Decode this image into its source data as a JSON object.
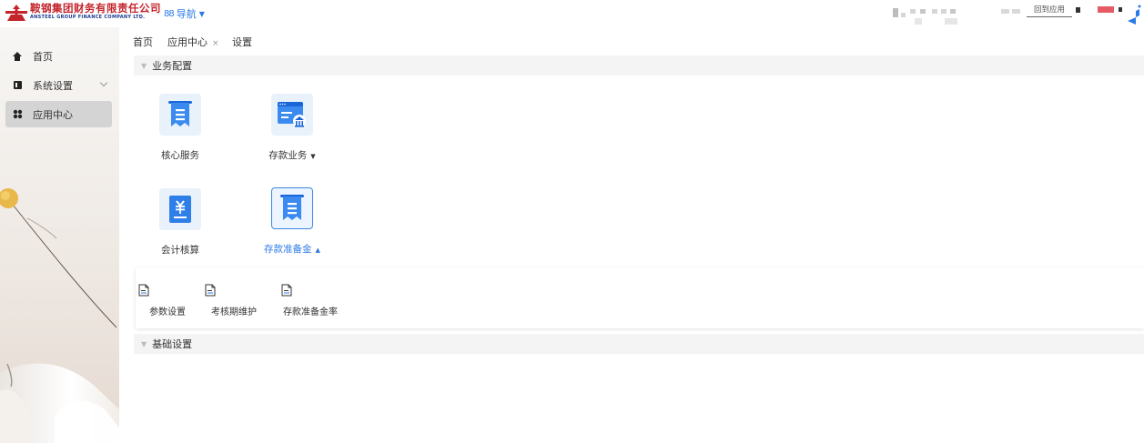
{
  "header": {
    "company_name_cn": "鞍钢集团财务有限责任公司",
    "company_name_en": "ANSTEEL GROUP FINANCE COMPANY LTD.",
    "nav_label": "导航",
    "back_to_app_label": "回到应用"
  },
  "sidebar": {
    "items": [
      {
        "label": "首页",
        "icon": "home-icon"
      },
      {
        "label": "系统设置",
        "icon": "settings-book-icon",
        "expandable": true
      },
      {
        "label": "应用中心",
        "icon": "app-grid-icon",
        "active": true
      }
    ]
  },
  "tabs": [
    {
      "label": "首页"
    },
    {
      "label": "应用中心",
      "closable": true,
      "active": true
    },
    {
      "label": "设置"
    }
  ],
  "sections": {
    "business": {
      "title": "业务配置",
      "apps": [
        {
          "label": "核心服务",
          "icon": "receipt-icon"
        },
        {
          "label": "存款业务",
          "icon": "bank-deposit-icon",
          "has_dropdown": true
        },
        {
          "label": "会计核算",
          "icon": "yuan-ledger-icon"
        },
        {
          "label": "存款准备金",
          "icon": "receipt-icon",
          "selected": true,
          "expanded": true
        }
      ],
      "sub_items": [
        {
          "label": "参数设置",
          "icon": "document-icon"
        },
        {
          "label": "考核期维护",
          "icon": "document-icon"
        },
        {
          "label": "存款准备金率",
          "icon": "document-icon"
        }
      ]
    },
    "basic": {
      "title": "基础设置"
    }
  },
  "colors": {
    "accent": "#2c7be5",
    "brand_red": "#c4252c",
    "brand_blue": "#1a3a8f",
    "icon_bg": "#e9f1fb",
    "section_bg": "#f4f4f4"
  }
}
